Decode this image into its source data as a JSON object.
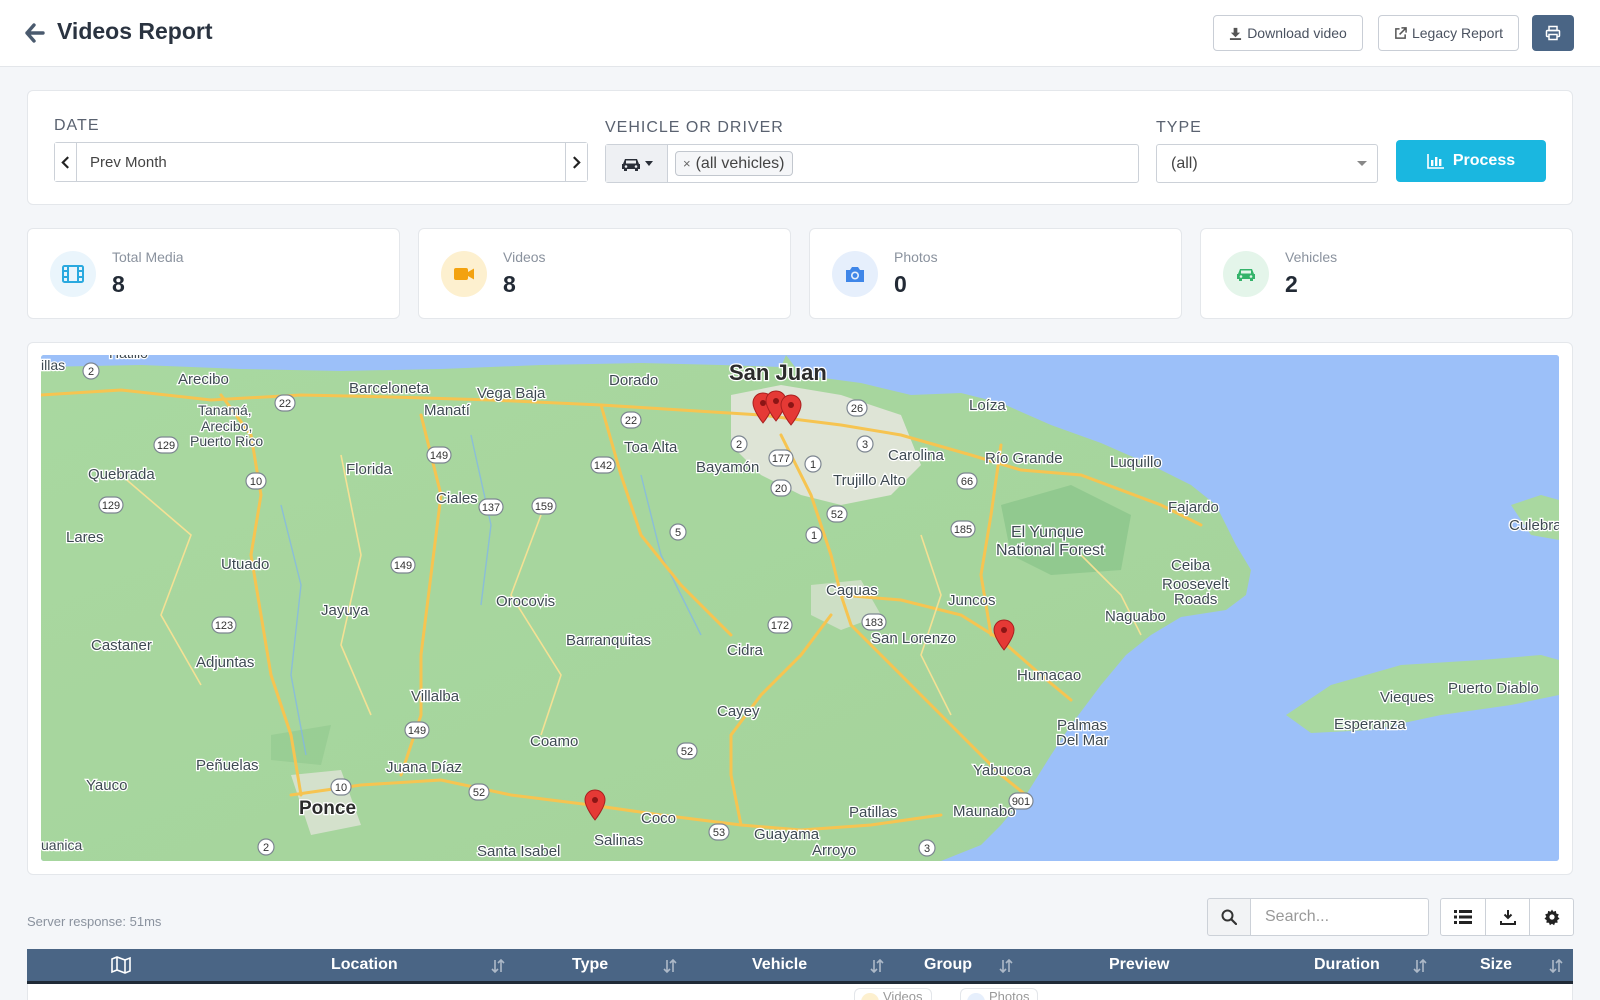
{
  "header": {
    "title": "Videos Report",
    "download_label": "Download video",
    "legacy_label": "Legacy Report"
  },
  "filters": {
    "date_label": "DATE",
    "date_value": "Prev Month",
    "vehicle_label": "VEHICLE OR DRIVER",
    "vehicle_tag": "(all vehicles)",
    "type_label": "TYPE",
    "type_value": "(all)",
    "process_label": "Process"
  },
  "stats": [
    {
      "label": "Total Media",
      "value": "8",
      "icon": "film-icon",
      "color": "#2aa9df",
      "bg": "#eaf5fc"
    },
    {
      "label": "Videos",
      "value": "8",
      "icon": "video-camera-icon",
      "color": "#f3a20f",
      "bg": "#fdf0cf"
    },
    {
      "label": "Photos",
      "value": "0",
      "icon": "camera-icon",
      "color": "#3f86e8",
      "bg": "#e6effc"
    },
    {
      "label": "Vehicles",
      "value": "2",
      "icon": "car-icon",
      "color": "#34b36a",
      "bg": "#e4f5ea"
    }
  ],
  "map": {
    "labels": {
      "san_juan": "San Juan",
      "arecibo": "Arecibo",
      "barceloneta": "Barceloneta",
      "vega_baja": "Vega Baja",
      "dorado": "Dorado",
      "manati": "Manatí",
      "tanama": "Tanamá,",
      "arecibo_pr_1": "Arecibo,",
      "arecibo_pr_2": "Puerto Rico",
      "quebrada": "Quebrada",
      "florida": "Florida",
      "toa_alta": "Toa Alta",
      "bayamon": "Bayamón",
      "carolina": "Carolina",
      "trujillo_alto": "Trujillo Alto",
      "loiza": "Loíza",
      "rio_grande": "Río Grande",
      "luquillo": "Luquillo",
      "fajardo": "Fajardo",
      "culebra": "Culebra",
      "yunque_1": "El Yunque",
      "yunque_2": "National Forest",
      "ceiba": "Ceiba",
      "roosevelt_1": "Roosevelt",
      "roosevelt_2": "Roads",
      "lares": "Lares",
      "utuado": "Utuado",
      "ciales": "Ciales",
      "jayuya": "Jayuya",
      "orocovis": "Orocovis",
      "caguas": "Caguas",
      "juncos": "Juncos",
      "naguabo": "Naguabo",
      "san_lorenzo": "San Lorenzo",
      "barranquitas": "Barranquitas",
      "cidra": "Cidra",
      "castaner": "Castaner",
      "adjuntas": "Adjuntas",
      "humacao": "Humacao",
      "vieques": "Vieques",
      "puerto_diablo": "Puerto Diablo",
      "esperanza": "Esperanza",
      "villalba": "Villalba",
      "cayey": "Cayey",
      "coamo": "Coamo",
      "palmas_1": "Palmas",
      "palmas_2": "Del Mar",
      "penuelas": "Peñuelas",
      "juana_diaz": "Juana Díaz",
      "yauco": "Yauco",
      "ponce": "Ponce",
      "yabucoa": "Yabucoa",
      "patillas": "Patillas",
      "maunabo": "Maunabo",
      "coco": "Coco",
      "salinas": "Salinas",
      "guayama": "Guayama",
      "arroyo": "Arroyo",
      "santa_isabel": "Santa Isabel",
      "guanica": "uanica",
      "illas": "illas",
      "hatillo": "Hatillo"
    },
    "route_shields": [
      "2",
      "22",
      "129",
      "10",
      "129",
      "22",
      "26",
      "2",
      "3",
      "177",
      "1",
      "142",
      "149",
      "137",
      "159",
      "20",
      "66",
      "5",
      "52",
      "1",
      "185",
      "149",
      "123",
      "183",
      "172",
      "149",
      "10",
      "52",
      "52",
      "53",
      "901",
      "3",
      "2"
    ]
  },
  "table": {
    "server_response": "Server response: 51ms",
    "search_placeholder": "Search...",
    "columns": {
      "location": "Location",
      "type": "Type",
      "vehicle": "Vehicle",
      "group": "Group",
      "preview": "Preview",
      "duration": "Duration",
      "size": "Size"
    },
    "peek_chips": [
      "Videos",
      "Photos"
    ]
  }
}
